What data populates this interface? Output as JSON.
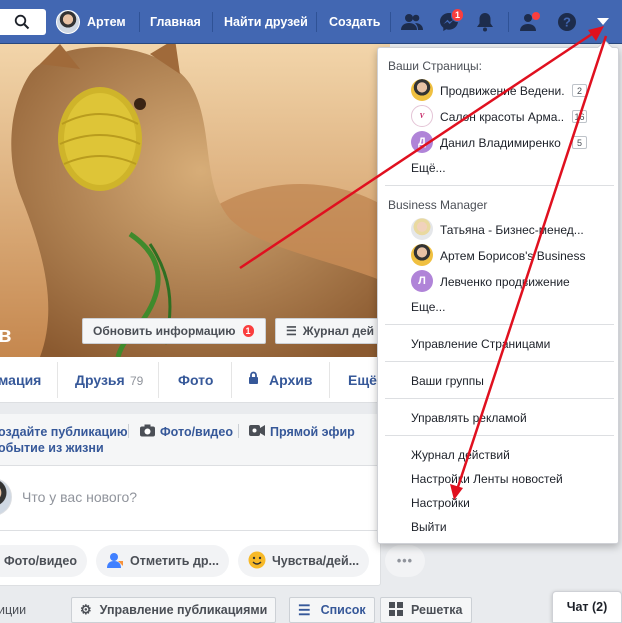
{
  "topbar": {
    "user_name": "Артем",
    "nav_home": "Главная",
    "nav_find_friends": "Найти друзей",
    "nav_create": "Создать",
    "messages_badge": "1",
    "brand_color": "#4267b2"
  },
  "cover": {
    "name_fragment": "в",
    "update_info_label": "Обновить информацию",
    "update_info_badge": "1",
    "activity_log_label": "Журнал дей"
  },
  "tabs": {
    "info": "мация",
    "friends": "Друзья",
    "friends_count": "79",
    "photos": "Фото",
    "archive": "Архив",
    "more": "Ещё"
  },
  "composer": {
    "create_post": "оздайте публикацию",
    "photo_video": "Фото/видео",
    "live": "Прямой эфир",
    "life_event": "обытие из жизни",
    "placeholder": "Что у вас нового?",
    "pill_photo": "Фото/видео",
    "pill_tag": "Отметить др...",
    "pill_feeling": "Чувства/дей...",
    "pill_more": "•••"
  },
  "bottom_bar": {
    "left_fragment": "иции",
    "manage_posts": "Управление публикациями",
    "list_view": "Список",
    "grid_view": "Решетка"
  },
  "dropdown": {
    "your_pages_header": "Ваши Страницы:",
    "pages": [
      {
        "name": "Продвижение Ведени...",
        "count": "2",
        "avatar": "photo"
      },
      {
        "name": "Салон красоты Арма...",
        "count": "16",
        "avatar": "logo"
      },
      {
        "name": "Данил Владимиренко",
        "count": "5",
        "avatar": "Д"
      }
    ],
    "pages_more": "Ещё...",
    "bm_header": "Business Manager",
    "bm_items": [
      {
        "name": "Татьяна - Бизнес-менед...",
        "avatar": "photo"
      },
      {
        "name": "Артем Борисов's Business",
        "avatar": "photo"
      },
      {
        "name": "Левченко продвижение",
        "avatar": "Л"
      }
    ],
    "bm_more": "Еще...",
    "manage_pages": "Управление Страницами",
    "your_groups": "Ваши группы",
    "manage_ads": "Управлять рекламой",
    "activity_log": "Журнал действий",
    "news_feed_settings": "Настройки Ленты новостей",
    "settings": "Настройки",
    "logout": "Выйти"
  },
  "chat": {
    "label": "Чат (2)"
  },
  "annotation_color": "#e0101f"
}
